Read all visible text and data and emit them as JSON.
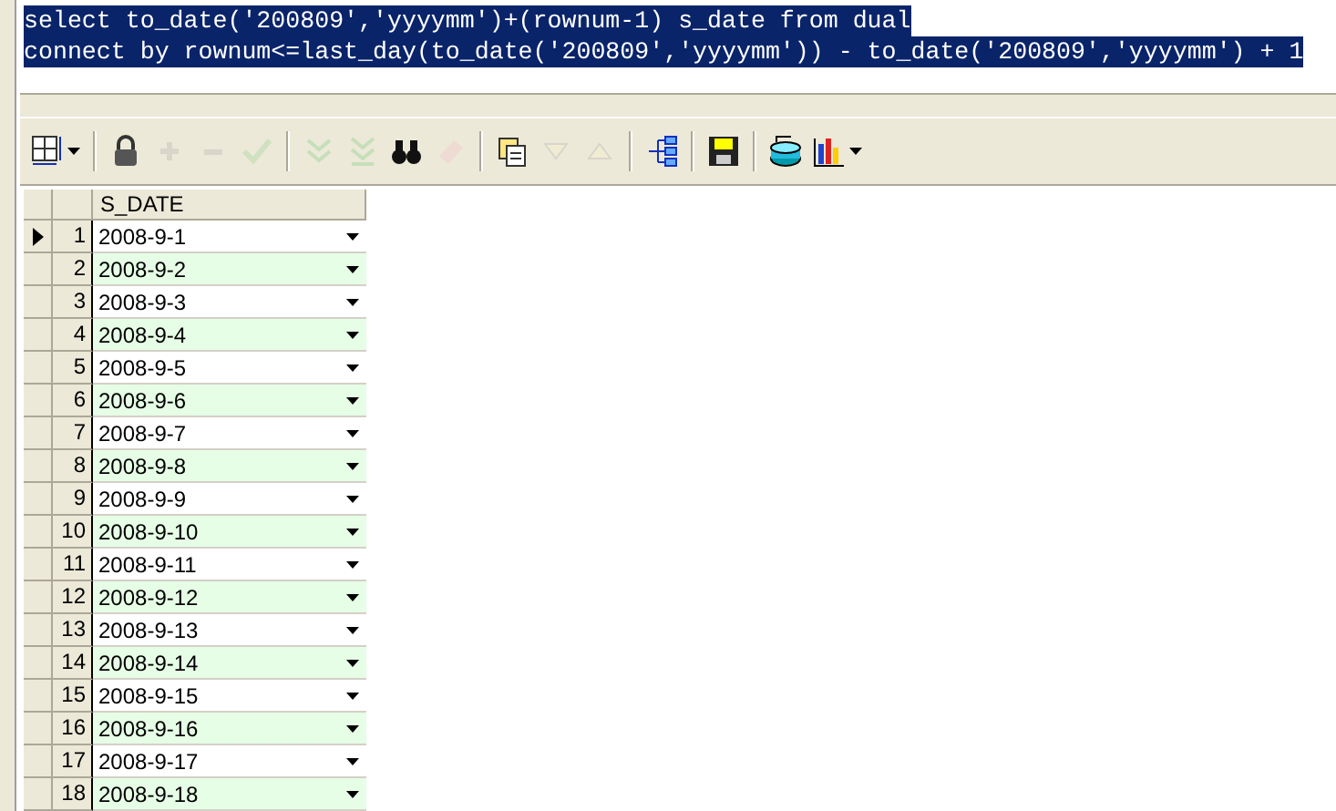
{
  "editor": {
    "lines": [
      "select to_date('200809','yyyymm')+(rownum-1) s_date from dual",
      "connect by rownum<=last_day(to_date('200809','yyyymm')) - to_date('200809','yyyymm') + 1"
    ],
    "selected": true
  },
  "toolbar": [
    {
      "kind": "grid",
      "disabled": false,
      "dropdown": true
    },
    {
      "kind": "sep"
    },
    {
      "kind": "lock",
      "disabled": false
    },
    {
      "kind": "plus",
      "disabled": true
    },
    {
      "kind": "minus",
      "disabled": true
    },
    {
      "kind": "check",
      "disabled": true
    },
    {
      "kind": "sep"
    },
    {
      "kind": "down2",
      "disabled": true
    },
    {
      "kind": "down2bar",
      "disabled": true
    },
    {
      "kind": "binoculars",
      "disabled": false
    },
    {
      "kind": "eraser",
      "disabled": true
    },
    {
      "kind": "sep"
    },
    {
      "kind": "pages",
      "disabled": false
    },
    {
      "kind": "tridown",
      "disabled": true
    },
    {
      "kind": "triup",
      "disabled": true
    },
    {
      "kind": "sep"
    },
    {
      "kind": "tree",
      "disabled": false
    },
    {
      "kind": "sep"
    },
    {
      "kind": "save",
      "disabled": false
    },
    {
      "kind": "sep"
    },
    {
      "kind": "database",
      "disabled": false
    },
    {
      "kind": "chart",
      "disabled": false,
      "dropdown": true
    }
  ],
  "table": {
    "columns": [
      "S_DATE"
    ],
    "rows": [
      {
        "number": "1",
        "value": "2008-9-1",
        "selected": true
      },
      {
        "number": "2",
        "value": "2008-9-2",
        "selected": false
      },
      {
        "number": "3",
        "value": "2008-9-3",
        "selected": false
      },
      {
        "number": "4",
        "value": "2008-9-4",
        "selected": false
      },
      {
        "number": "5",
        "value": "2008-9-5",
        "selected": false
      },
      {
        "number": "6",
        "value": "2008-9-6",
        "selected": false
      },
      {
        "number": "7",
        "value": "2008-9-7",
        "selected": false
      },
      {
        "number": "8",
        "value": "2008-9-8",
        "selected": false
      },
      {
        "number": "9",
        "value": "2008-9-9",
        "selected": false
      },
      {
        "number": "10",
        "value": "2008-9-10",
        "selected": false
      },
      {
        "number": "11",
        "value": "2008-9-11",
        "selected": false
      },
      {
        "number": "12",
        "value": "2008-9-12",
        "selected": false
      },
      {
        "number": "13",
        "value": "2008-9-13",
        "selected": false
      },
      {
        "number": "14",
        "value": "2008-9-14",
        "selected": false
      },
      {
        "number": "15",
        "value": "2008-9-15",
        "selected": false
      },
      {
        "number": "16",
        "value": "2008-9-16",
        "selected": false
      },
      {
        "number": "17",
        "value": "2008-9-17",
        "selected": false
      },
      {
        "number": "18",
        "value": "2008-9-18",
        "selected": false
      }
    ]
  }
}
